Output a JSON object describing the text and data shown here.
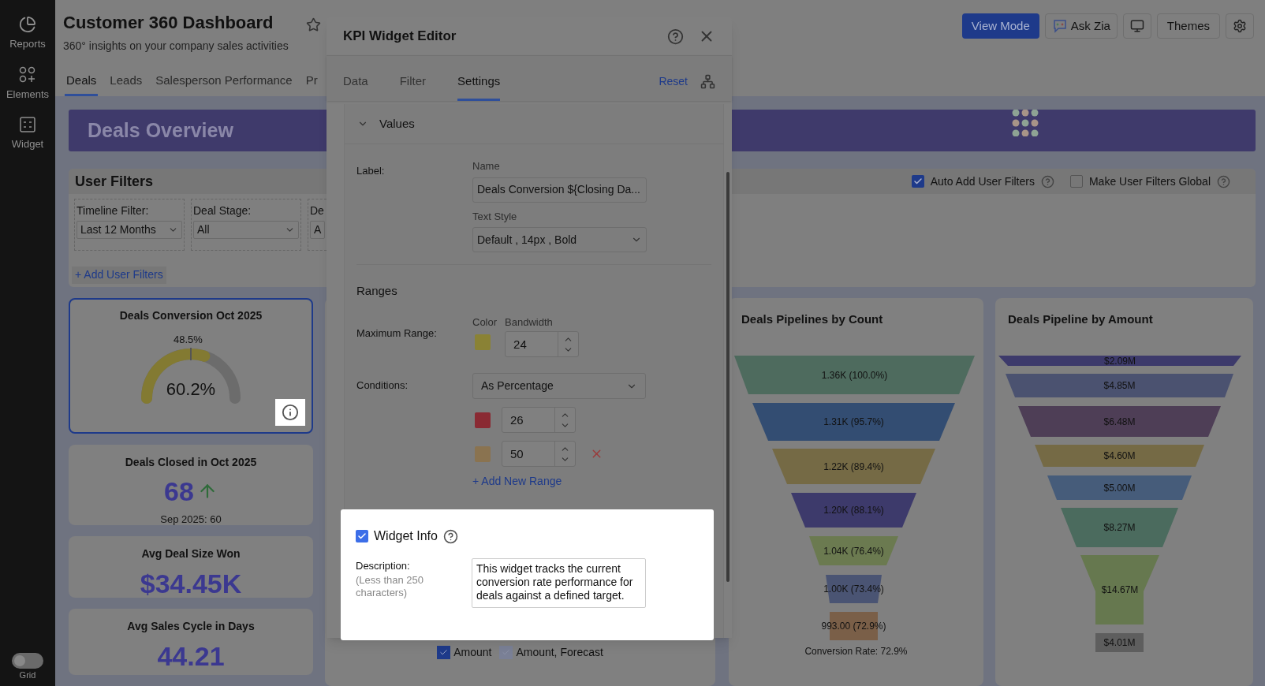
{
  "sidebar": {
    "items": [
      {
        "kind": "reports",
        "label": "Reports"
      },
      {
        "kind": "elements",
        "label": "Elements"
      },
      {
        "kind": "widget",
        "label": "Widget"
      }
    ],
    "grid_toggle": {
      "label": "Grid",
      "on": false
    }
  },
  "header": {
    "title": "Customer 360 Dashboard",
    "subtitle": "360° insights on your company sales activities",
    "buttons": [
      {
        "kind": "primary",
        "label": "View Mode"
      },
      {
        "kind": "zia",
        "label": "Ask Zia"
      },
      {
        "kind": "monitor"
      },
      {
        "kind": "text",
        "label": "Themes"
      },
      {
        "kind": "settings"
      }
    ]
  },
  "tabs": [
    {
      "label": "Deals",
      "selected": true
    },
    {
      "label": "Leads",
      "selected": false
    },
    {
      "label": "Salesperson Performance",
      "selected": false
    },
    {
      "label": "Pr",
      "selected": false
    }
  ],
  "banner": {
    "title": "Deals Overview"
  },
  "user_filters": {
    "title": "User Filters",
    "options": [
      {
        "label": "Auto Add User Filters",
        "checked": true
      },
      {
        "label": "Make User Filters Global",
        "checked": false
      }
    ],
    "filters": [
      {
        "label": "Timeline Filter:",
        "value": "Last 12 Months"
      },
      {
        "label": "Deal Stage:",
        "value": "All"
      },
      {
        "label": "De",
        "value": "A"
      }
    ],
    "add_link": "+ Add User Filters"
  },
  "kpi_cards": [
    {
      "kind": "gauge",
      "title": "Deals Conversion Oct 2025",
      "target": "48.5%",
      "value": "60.2%",
      "level": 0.6,
      "selected": true
    },
    {
      "kind": "trend",
      "title": "Deals Closed in Oct 2025",
      "value": "68",
      "rising": true,
      "comparison": "Sep 2025: 60",
      "selected": false
    },
    {
      "kind": "number",
      "title": "Avg Deal Size Won",
      "value": "$34.45K",
      "selected": false
    },
    {
      "kind": "number",
      "title": "Avg Sales Cycle in Days",
      "value": "44.21",
      "selected": false
    }
  ],
  "chart_legend": [
    {
      "label": "Amount",
      "active": true
    },
    {
      "label": "Amount, Forecast",
      "active": false
    }
  ],
  "funnels": [
    {
      "title": "Deals Pipelines by Count",
      "footer": "Conversion Rate: 72.9%",
      "segments": [
        {
          "label": "1.36K (100.0%)",
          "color": "#4e6b5e"
        },
        {
          "label": "1.31K (95.7%)",
          "color": "#334d72"
        },
        {
          "label": "1.22K (89.4%)",
          "color": "#756a45"
        },
        {
          "label": "1.20K (88.1%)",
          "color": "#3d3a6b"
        },
        {
          "label": "1.04K (76.4%)",
          "color": "#6b7a50"
        },
        {
          "label": "1.00K (73.4%)",
          "color": "#4a5473"
        },
        {
          "label": "993.00 (72.9%)",
          "color": "#7a5f48"
        }
      ]
    },
    {
      "title": "Deals Pipeline by Amount",
      "segments": [
        {
          "label": "$2.09M",
          "color": "#3d3a6b"
        },
        {
          "label": "$4.85M",
          "color": "#4b5270"
        },
        {
          "label": "$6.48M",
          "color": "#4e3e56"
        },
        {
          "label": "$4.60M",
          "color": "#756a45"
        },
        {
          "label": "$5.00M",
          "color": "#465c7a"
        },
        {
          "label": "$8.27M",
          "color": "#4b6b5e"
        },
        {
          "label": "$14.67M",
          "color": "#66784f"
        },
        {
          "label": "$4.01M",
          "color": "#5e5e5e"
        }
      ]
    }
  ],
  "editor": {
    "title": "KPI Widget Editor",
    "tabs": [
      {
        "label": "Data",
        "selected": false
      },
      {
        "label": "Filter",
        "selected": false
      },
      {
        "label": "Settings",
        "selected": true
      }
    ],
    "reset": "Reset",
    "values": {
      "title": "Values",
      "expanded": true,
      "label_caption": "Label:",
      "name_caption": "Name",
      "name_value": "Deals Conversion ${Closing Da...",
      "style_caption": "Text Style",
      "style_value": "Default , 14px , Bold"
    },
    "ranges": {
      "title": "Ranges",
      "max_caption": "Maximum Range:",
      "color_caption": "Color",
      "bandwidth_caption": "Bandwidth",
      "maximum": {
        "color": "#8a8235",
        "bandwidth": "24"
      },
      "conditions_caption": "Conditions:",
      "conditions_value": "As Percentage",
      "conditions": [
        {
          "color": "#8a2a33",
          "value": "26",
          "removable": false
        },
        {
          "color": "#8a7350",
          "value": "50",
          "removable": true
        }
      ],
      "add_link": "+ Add New Range"
    },
    "widget_info": {
      "title": "Widget Info",
      "checked": true,
      "description_caption": "Description:",
      "description_hint": "(Less than 250 characters)",
      "description": "This widget tracks the current conversion rate performance for deals against a defined target."
    }
  }
}
